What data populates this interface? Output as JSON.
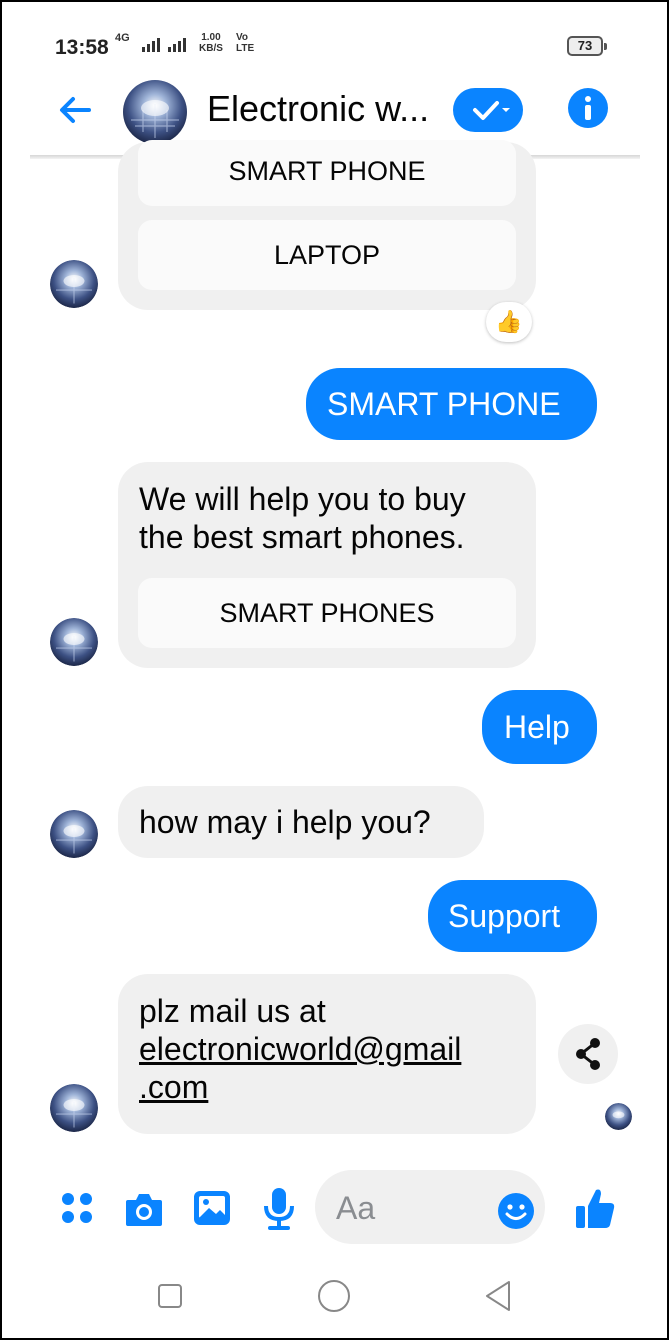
{
  "status_bar": {
    "time": "13:58",
    "network_label": "4G",
    "data_speed": "1.00",
    "data_unit": "KB/S",
    "volte_top": "Vo",
    "volte_bottom": "LTE",
    "battery": "73"
  },
  "header": {
    "title": "Electronic w...",
    "back_icon": "arrow-left-icon",
    "verified_icon": "check-dropdown-icon",
    "info_icon": "info-icon"
  },
  "conversation": {
    "msg1_quick_replies": [
      "SMART PHONE",
      "LAPTOP"
    ],
    "msg1_reaction": "👍",
    "user_msg1": "SMART PHONE",
    "msg2_lines": [
      "We will help you to buy",
      "the best smart phones."
    ],
    "msg2_quick_reply": "SMART PHONES",
    "user_msg2": "Help",
    "msg3": "how may i help you?",
    "user_msg3": "Support",
    "msg4_line1": "plz mail us at",
    "msg4_email_part1": "electronicworld@gmail",
    "msg4_email_part2": ".com"
  },
  "composer": {
    "placeholder": "Aa",
    "icons": [
      "grid-dots-icon",
      "camera-icon",
      "image-icon",
      "microphone-icon",
      "emoji-icon",
      "thumbs-up-icon"
    ]
  },
  "nav_bar": {
    "icons": [
      "square-recents-icon",
      "circle-home-icon",
      "triangle-back-icon"
    ]
  },
  "colors": {
    "accent": "#0a84ff",
    "bubble_gray": "#f0f0f0",
    "text": "#050505"
  }
}
